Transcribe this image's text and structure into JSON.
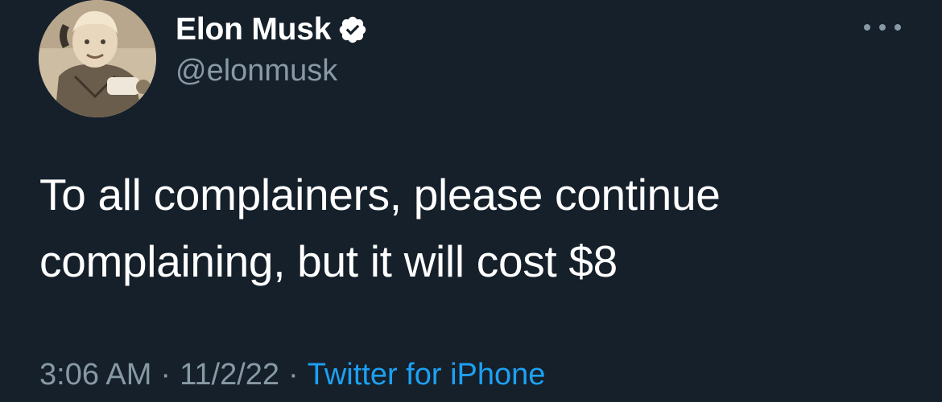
{
  "author": {
    "display_name": "Elon Musk",
    "handle": "@elonmusk",
    "verified": true,
    "avatar_icon": "avatar-photo"
  },
  "tweet": {
    "text": "To all complainers, please continue complaining, but it will cost $8",
    "time": "3:06 AM",
    "date": "11/2/22",
    "separator": "·",
    "source": "Twitter for iPhone"
  },
  "colors": {
    "background": "#15202b",
    "text": "#ffffff",
    "muted": "#8899a6",
    "link": "#1da1f2",
    "verified": "#ffffff"
  },
  "icons": {
    "more": "more-horizontal-icon",
    "verified": "verified-badge-icon"
  }
}
